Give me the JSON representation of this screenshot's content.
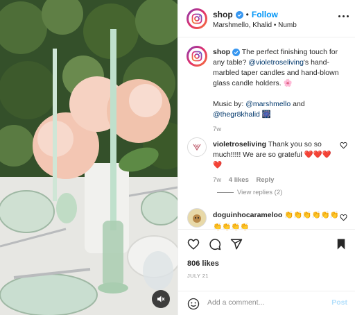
{
  "header": {
    "username": "shop",
    "separator": "•",
    "follow_label": "Follow",
    "audio": "Marshmello, Khalid • Numb"
  },
  "caption": {
    "username": "shop",
    "text_part1": "The perfect finishing touch for any table?",
    "mention": "@violetroseliving",
    "text_part2": "'s hand-marbled taper candles and hand-blown glass candle holders.",
    "emoji": "🌸",
    "music_prefix": "Music by:",
    "music_mention1": "@marshmello",
    "music_and": "and",
    "music_mention2": "@thegr8khalid",
    "music_emoji": "🎆",
    "age": "7w"
  },
  "comments": [
    {
      "username": "violetroseliving",
      "text": "Thank you so so much!!!!! We are so grateful",
      "emojis": "❤️❤️❤️❤️",
      "age": "7w",
      "likes": "4 likes",
      "reply_label": "Reply",
      "view_replies": "View replies (2)"
    },
    {
      "username": "doguinhocarameloo",
      "emojis": "👏👏👏👏👏👏👏👏👏👏"
    }
  ],
  "actions": {
    "likes_count": "806 likes",
    "date": "JULY 21",
    "comment_placeholder": "Add a comment...",
    "post_label": "Post"
  },
  "icons": {
    "brand": "instagram-logo-icon",
    "verified": "verified-badge-icon",
    "mute": "speaker-muted-icon",
    "more": "more-options-icon",
    "like": "heart-icon",
    "comment": "comment-icon",
    "share": "share-icon",
    "save": "bookmark-icon",
    "emoji": "smiley-icon"
  },
  "colors": {
    "accent": "#0095f6",
    "verified": "#3897f0",
    "muted_text": "#8e8e8e",
    "link": "#00376b",
    "post_disabled": "#b2dffc"
  }
}
